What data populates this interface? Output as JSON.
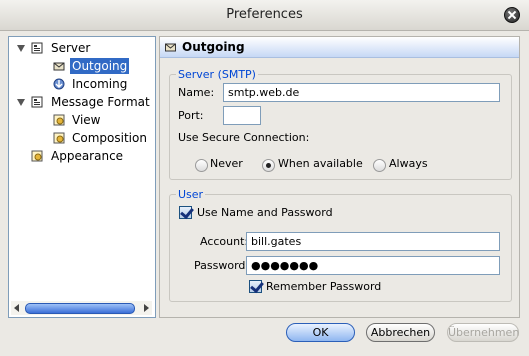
{
  "window": {
    "title": "Preferences"
  },
  "tree": {
    "items": [
      {
        "label": "Server"
      },
      {
        "label": "Outgoing"
      },
      {
        "label": "Incoming"
      },
      {
        "label": "Message Format"
      },
      {
        "label": "View"
      },
      {
        "label": "Composition"
      },
      {
        "label": "Appearance"
      }
    ],
    "selected": "Outgoing"
  },
  "panel": {
    "title": "Outgoing",
    "server_group": {
      "legend": "Server (SMTP)",
      "name_label": "Name:",
      "name_value": "smtp.web.de",
      "port_label": "Port:",
      "port_value": "",
      "secure_label": "Use Secure Connection:",
      "options": [
        "Never",
        "When available",
        "Always"
      ],
      "selected_option": "When available"
    },
    "user_group": {
      "legend": "User",
      "use_auth_label": "Use Name and Password",
      "use_auth_checked": true,
      "account_label": "Account:",
      "account_value": "bill.gates",
      "password_label": "Password:",
      "password_value": "●●●●●●●",
      "remember_label": "Remember Password",
      "remember_checked": true
    }
  },
  "buttons": {
    "ok": "OK",
    "cancel": "Abbrechen",
    "apply": "Übernehmen"
  }
}
